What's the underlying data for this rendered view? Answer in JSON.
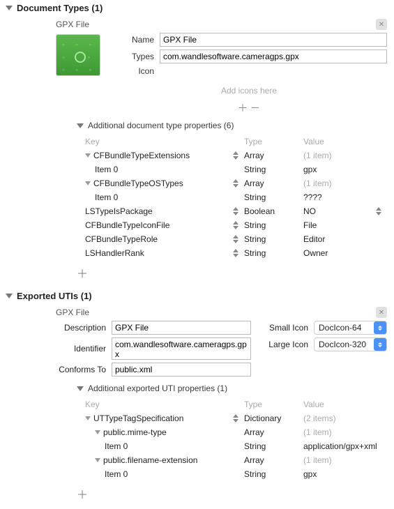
{
  "sections": {
    "docTypes": {
      "header": "Document Types (1)",
      "item": {
        "title": "GPX File",
        "fields": {
          "nameLabel": "Name",
          "nameValue": "GPX File",
          "typesLabel": "Types",
          "typesValue": "com.wandlesoftware.cameragps.gpx",
          "iconLabel": "Icon",
          "addIconsHint": "Add icons here"
        },
        "additional": {
          "header": "Additional document type properties (6)",
          "columns": {
            "key": "Key",
            "type": "Type",
            "value": "Value"
          },
          "rows": [
            {
              "indent": 0,
              "disc": true,
              "key": "CFBundleTypeExtensions",
              "stepper": true,
              "type": "Array",
              "value": "(1 item)",
              "muted": true
            },
            {
              "indent": 1,
              "key": "Item 0",
              "type": "String",
              "value": "gpx"
            },
            {
              "indent": 0,
              "disc": true,
              "key": "CFBundleTypeOSTypes",
              "stepper": true,
              "type": "Array",
              "value": "(1 item)",
              "muted": true
            },
            {
              "indent": 1,
              "key": "Item 0",
              "type": "String",
              "value": "????"
            },
            {
              "indent": 0,
              "key": "LSTypeIsPackage",
              "stepper": true,
              "type": "Boolean",
              "value": "NO",
              "valueStepper": true
            },
            {
              "indent": 0,
              "key": "CFBundleTypeIconFile",
              "stepper": true,
              "type": "String",
              "value": "File"
            },
            {
              "indent": 0,
              "key": "CFBundleTypeRole",
              "stepper": true,
              "type": "String",
              "value": "Editor"
            },
            {
              "indent": 0,
              "key": "LSHandlerRank",
              "stepper": true,
              "type": "String",
              "value": "Owner"
            }
          ]
        }
      }
    },
    "exportedUTIs": {
      "header": "Exported UTIs (1)",
      "item": {
        "title": "GPX File",
        "fields": {
          "descriptionLabel": "Description",
          "descriptionValue": "GPX File",
          "identifierLabel": "Identifier",
          "identifierValue": "com.wandlesoftware.cameragps.gpx",
          "conformsLabel": "Conforms To",
          "conformsValue": "public.xml",
          "smallIconLabel": "Small Icon",
          "smallIconValue": "DocIcon-64",
          "largeIconLabel": "Large Icon",
          "largeIconValue": "DocIcon-320"
        },
        "additional": {
          "header": "Additional exported UTI properties (1)",
          "columns": {
            "key": "Key",
            "type": "Type",
            "value": "Value"
          },
          "rows": [
            {
              "indent": 0,
              "disc": true,
              "key": "UTTypeTagSpecification",
              "stepper": true,
              "type": "Dictionary",
              "value": "(2 items)",
              "muted": true
            },
            {
              "indent": 1,
              "disc": true,
              "key": "public.mime-type",
              "type": "Array",
              "value": "(1 item)",
              "muted": true
            },
            {
              "indent": 2,
              "key": "Item 0",
              "type": "String",
              "value": "application/gpx+xml"
            },
            {
              "indent": 1,
              "disc": true,
              "key": "public.filename-extension",
              "type": "Array",
              "value": "(1 item)",
              "muted": true
            },
            {
              "indent": 2,
              "key": "Item 0",
              "type": "String",
              "value": "gpx"
            }
          ]
        }
      }
    }
  },
  "glyphs": {
    "plus": "＋",
    "minus": "－",
    "x": "✕"
  }
}
